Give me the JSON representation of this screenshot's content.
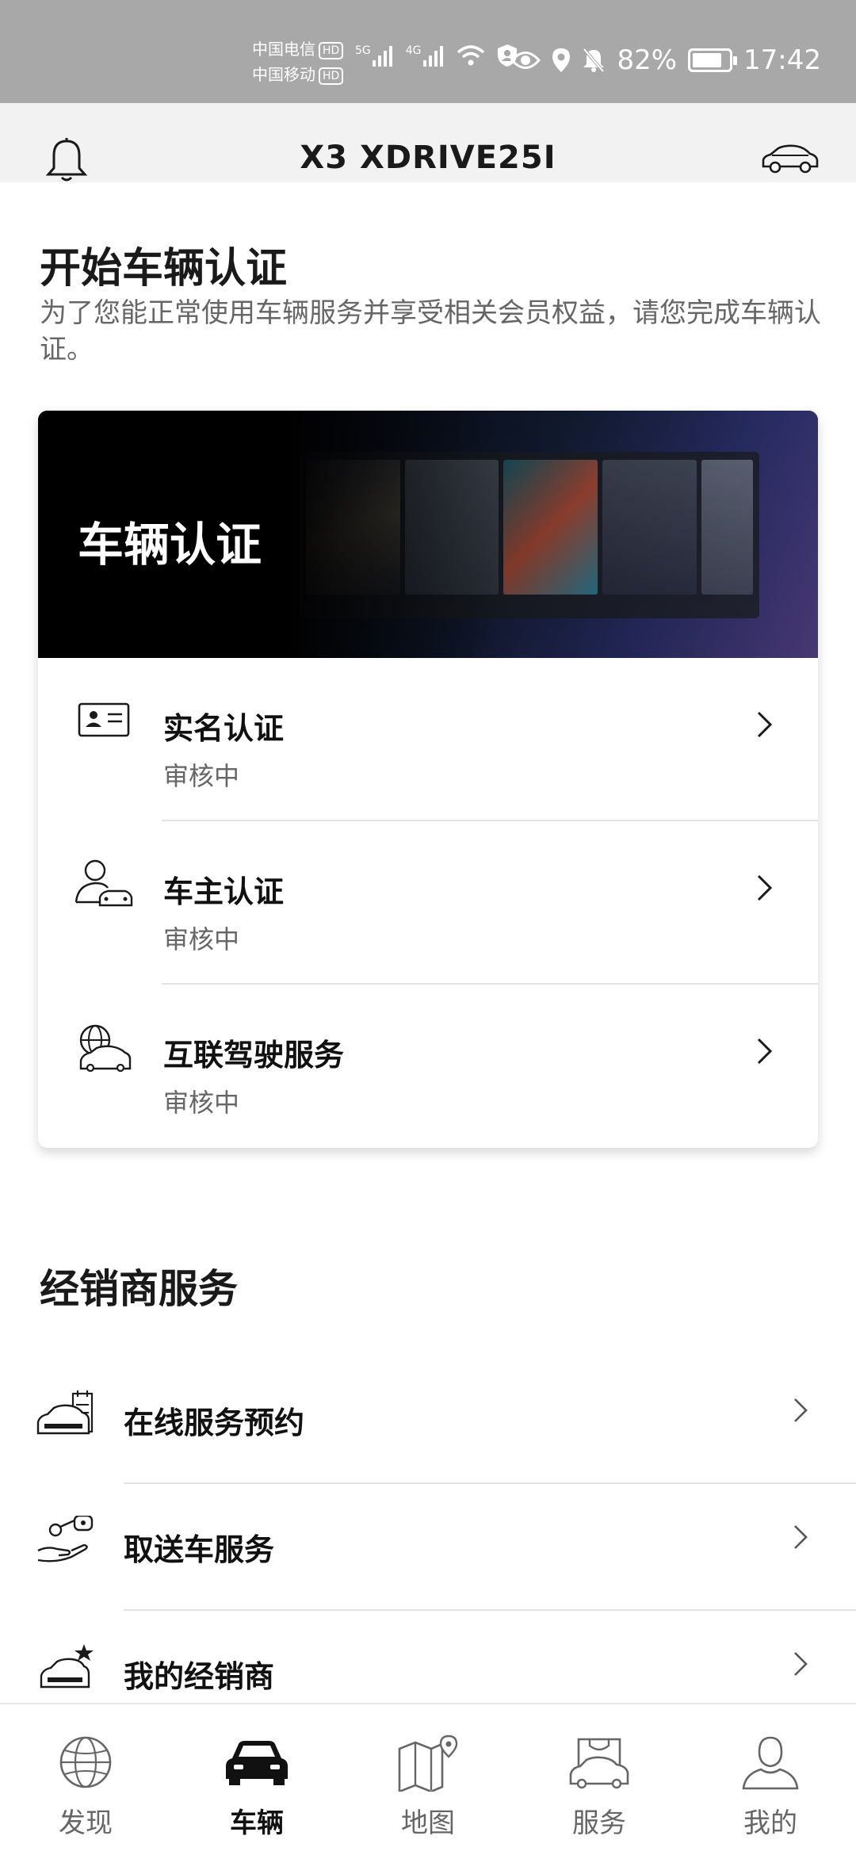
{
  "status_bar": {
    "carrier1": "中国电信",
    "carrier2": "中国移动",
    "hd": "HD",
    "net1": "5G",
    "net2": "4G",
    "battery": "82%",
    "battery_level": 0.82,
    "time": "17:42"
  },
  "header": {
    "title": "X3 XDRIVE25I",
    "left_icon": "bell-icon",
    "right_icon": "car-outline-icon"
  },
  "intro": {
    "title": "开始车辆认证",
    "description": "为了您能正常使用车辆服务并享受相关会员权益，请您完成车辆认证。"
  },
  "verification": {
    "banner_title": "车辆认证",
    "items": [
      {
        "label": "实名认证",
        "status": "审核中",
        "icon": "id-card-icon"
      },
      {
        "label": "车主认证",
        "status": "审核中",
        "icon": "owner-car-icon"
      },
      {
        "label": "互联驾驶服务",
        "status": "审核中",
        "icon": "globe-car-icon"
      }
    ]
  },
  "dealer": {
    "title": "经销商服务",
    "items": [
      {
        "label": "在线服务预约",
        "icon": "car-calendar-icon"
      },
      {
        "label": "取送车服务",
        "icon": "key-handover-icon"
      },
      {
        "label": "我的经销商",
        "icon": "car-star-icon"
      }
    ]
  },
  "bottom_nav": {
    "active": "车辆",
    "items": [
      {
        "label": "发现",
        "icon": "globe-icon"
      },
      {
        "label": "车辆",
        "icon": "car-front-icon"
      },
      {
        "label": "地图",
        "icon": "map-icon"
      },
      {
        "label": "服务",
        "icon": "service-bag-icon"
      },
      {
        "label": "我的",
        "icon": "profile-icon"
      }
    ]
  }
}
